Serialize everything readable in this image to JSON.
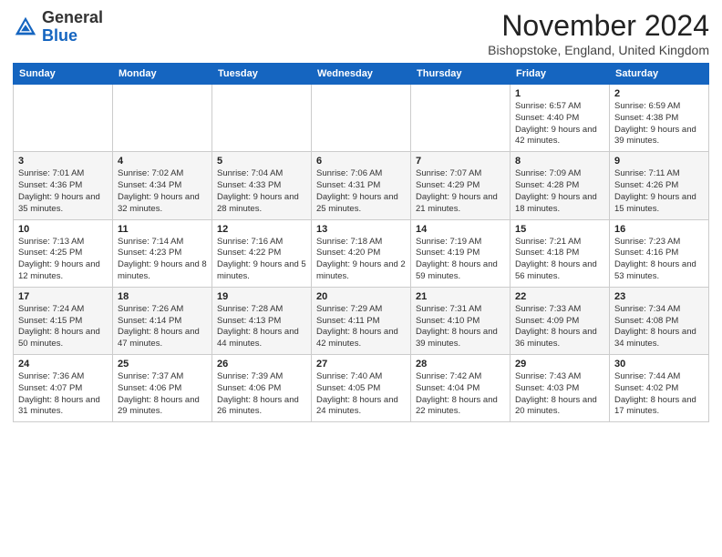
{
  "header": {
    "logo_general": "General",
    "logo_blue": "Blue",
    "month_title": "November 2024",
    "location": "Bishopstoke, England, United Kingdom"
  },
  "weekdays": [
    "Sunday",
    "Monday",
    "Tuesday",
    "Wednesday",
    "Thursday",
    "Friday",
    "Saturday"
  ],
  "weeks": [
    [
      {
        "day": "",
        "info": ""
      },
      {
        "day": "",
        "info": ""
      },
      {
        "day": "",
        "info": ""
      },
      {
        "day": "",
        "info": ""
      },
      {
        "day": "",
        "info": ""
      },
      {
        "day": "1",
        "info": "Sunrise: 6:57 AM\nSunset: 4:40 PM\nDaylight: 9 hours and 42 minutes."
      },
      {
        "day": "2",
        "info": "Sunrise: 6:59 AM\nSunset: 4:38 PM\nDaylight: 9 hours and 39 minutes."
      }
    ],
    [
      {
        "day": "3",
        "info": "Sunrise: 7:01 AM\nSunset: 4:36 PM\nDaylight: 9 hours and 35 minutes."
      },
      {
        "day": "4",
        "info": "Sunrise: 7:02 AM\nSunset: 4:34 PM\nDaylight: 9 hours and 32 minutes."
      },
      {
        "day": "5",
        "info": "Sunrise: 7:04 AM\nSunset: 4:33 PM\nDaylight: 9 hours and 28 minutes."
      },
      {
        "day": "6",
        "info": "Sunrise: 7:06 AM\nSunset: 4:31 PM\nDaylight: 9 hours and 25 minutes."
      },
      {
        "day": "7",
        "info": "Sunrise: 7:07 AM\nSunset: 4:29 PM\nDaylight: 9 hours and 21 minutes."
      },
      {
        "day": "8",
        "info": "Sunrise: 7:09 AM\nSunset: 4:28 PM\nDaylight: 9 hours and 18 minutes."
      },
      {
        "day": "9",
        "info": "Sunrise: 7:11 AM\nSunset: 4:26 PM\nDaylight: 9 hours and 15 minutes."
      }
    ],
    [
      {
        "day": "10",
        "info": "Sunrise: 7:13 AM\nSunset: 4:25 PM\nDaylight: 9 hours and 12 minutes."
      },
      {
        "day": "11",
        "info": "Sunrise: 7:14 AM\nSunset: 4:23 PM\nDaylight: 9 hours and 8 minutes."
      },
      {
        "day": "12",
        "info": "Sunrise: 7:16 AM\nSunset: 4:22 PM\nDaylight: 9 hours and 5 minutes."
      },
      {
        "day": "13",
        "info": "Sunrise: 7:18 AM\nSunset: 4:20 PM\nDaylight: 9 hours and 2 minutes."
      },
      {
        "day": "14",
        "info": "Sunrise: 7:19 AM\nSunset: 4:19 PM\nDaylight: 8 hours and 59 minutes."
      },
      {
        "day": "15",
        "info": "Sunrise: 7:21 AM\nSunset: 4:18 PM\nDaylight: 8 hours and 56 minutes."
      },
      {
        "day": "16",
        "info": "Sunrise: 7:23 AM\nSunset: 4:16 PM\nDaylight: 8 hours and 53 minutes."
      }
    ],
    [
      {
        "day": "17",
        "info": "Sunrise: 7:24 AM\nSunset: 4:15 PM\nDaylight: 8 hours and 50 minutes."
      },
      {
        "day": "18",
        "info": "Sunrise: 7:26 AM\nSunset: 4:14 PM\nDaylight: 8 hours and 47 minutes."
      },
      {
        "day": "19",
        "info": "Sunrise: 7:28 AM\nSunset: 4:13 PM\nDaylight: 8 hours and 44 minutes."
      },
      {
        "day": "20",
        "info": "Sunrise: 7:29 AM\nSunset: 4:11 PM\nDaylight: 8 hours and 42 minutes."
      },
      {
        "day": "21",
        "info": "Sunrise: 7:31 AM\nSunset: 4:10 PM\nDaylight: 8 hours and 39 minutes."
      },
      {
        "day": "22",
        "info": "Sunrise: 7:33 AM\nSunset: 4:09 PM\nDaylight: 8 hours and 36 minutes."
      },
      {
        "day": "23",
        "info": "Sunrise: 7:34 AM\nSunset: 4:08 PM\nDaylight: 8 hours and 34 minutes."
      }
    ],
    [
      {
        "day": "24",
        "info": "Sunrise: 7:36 AM\nSunset: 4:07 PM\nDaylight: 8 hours and 31 minutes."
      },
      {
        "day": "25",
        "info": "Sunrise: 7:37 AM\nSunset: 4:06 PM\nDaylight: 8 hours and 29 minutes."
      },
      {
        "day": "26",
        "info": "Sunrise: 7:39 AM\nSunset: 4:06 PM\nDaylight: 8 hours and 26 minutes."
      },
      {
        "day": "27",
        "info": "Sunrise: 7:40 AM\nSunset: 4:05 PM\nDaylight: 8 hours and 24 minutes."
      },
      {
        "day": "28",
        "info": "Sunrise: 7:42 AM\nSunset: 4:04 PM\nDaylight: 8 hours and 22 minutes."
      },
      {
        "day": "29",
        "info": "Sunrise: 7:43 AM\nSunset: 4:03 PM\nDaylight: 8 hours and 20 minutes."
      },
      {
        "day": "30",
        "info": "Sunrise: 7:44 AM\nSunset: 4:02 PM\nDaylight: 8 hours and 17 minutes."
      }
    ]
  ]
}
